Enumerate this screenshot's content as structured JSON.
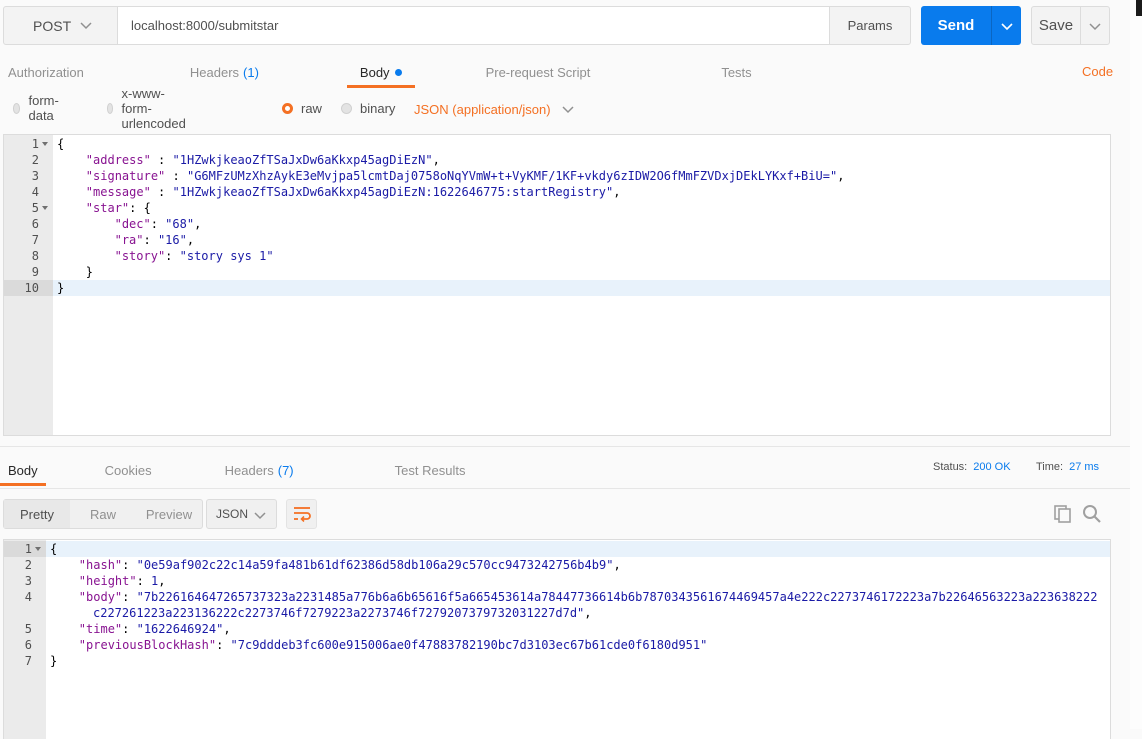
{
  "request": {
    "method": "POST",
    "url": "localhost:8000/submitstar",
    "params_label": "Params",
    "send_label": "Send",
    "save_label": "Save"
  },
  "request_tabs": [
    {
      "label": "Authorization",
      "count": null,
      "active": false,
      "dot": false
    },
    {
      "label": "Headers",
      "count": "(1)",
      "active": false,
      "dot": false
    },
    {
      "label": "Body",
      "count": null,
      "active": true,
      "dot": true
    },
    {
      "label": "Pre-request Script",
      "count": null,
      "active": false,
      "dot": false
    },
    {
      "label": "Tests",
      "count": null,
      "active": false,
      "dot": false
    }
  ],
  "code_link": "Code",
  "body_modes": [
    {
      "label": "form-data",
      "selected": false
    },
    {
      "label": "x-www-form-urlencoded",
      "selected": false
    },
    {
      "label": "raw",
      "selected": true
    },
    {
      "label": "binary",
      "selected": false
    }
  ],
  "content_type": "JSON (application/json)",
  "request_body": {
    "lines": [
      {
        "n": "1",
        "fold": true,
        "indent": 0,
        "parts": [
          [
            "p",
            "{"
          ]
        ]
      },
      {
        "n": "2",
        "fold": false,
        "indent": 1,
        "parts": [
          [
            "k",
            "\"address\""
          ],
          [
            "p",
            " : "
          ],
          [
            "s",
            "\"1HZwkjkeaoZfTSaJxDw6aKkxp45agDiEzN\""
          ],
          [
            "p",
            ","
          ]
        ]
      },
      {
        "n": "3",
        "fold": false,
        "indent": 1,
        "parts": [
          [
            "k",
            "\"signature\""
          ],
          [
            "p",
            " : "
          ],
          [
            "s",
            "\"G6MFzUMzXhzAykE3eMvjpa5lcmtDaj0758oNqYVmW+t+VyKMF/1KF+vkdy6zIDW2O6fMmFZVDxjDEkLYKxf+BiU=\""
          ],
          [
            "p",
            ","
          ]
        ]
      },
      {
        "n": "4",
        "fold": false,
        "indent": 1,
        "parts": [
          [
            "k",
            "\"message\""
          ],
          [
            "p",
            " : "
          ],
          [
            "s",
            "\"1HZwkjkeaoZfTSaJxDw6aKkxp45agDiEzN:1622646775:startRegistry\""
          ],
          [
            "p",
            ","
          ]
        ]
      },
      {
        "n": "5",
        "fold": true,
        "indent": 1,
        "parts": [
          [
            "k",
            "\"star\""
          ],
          [
            "p",
            ": {"
          ]
        ]
      },
      {
        "n": "6",
        "fold": false,
        "indent": 2,
        "parts": [
          [
            "k",
            "\"dec\""
          ],
          [
            "p",
            ": "
          ],
          [
            "s",
            "\"68\""
          ],
          [
            "p",
            ","
          ]
        ]
      },
      {
        "n": "7",
        "fold": false,
        "indent": 2,
        "parts": [
          [
            "k",
            "\"ra\""
          ],
          [
            "p",
            ": "
          ],
          [
            "s",
            "\"16\""
          ],
          [
            "p",
            ","
          ]
        ]
      },
      {
        "n": "8",
        "fold": false,
        "indent": 2,
        "parts": [
          [
            "k",
            "\"story\""
          ],
          [
            "p",
            ": "
          ],
          [
            "s",
            "\"story sys 1\""
          ]
        ]
      },
      {
        "n": "9",
        "fold": false,
        "indent": 1,
        "parts": [
          [
            "p",
            "}"
          ]
        ]
      },
      {
        "n": "10",
        "fold": false,
        "indent": 0,
        "parts": [
          [
            "p",
            "}"
          ]
        ],
        "highlight": true
      }
    ]
  },
  "response_tabs": [
    {
      "label": "Body",
      "count": null,
      "active": true
    },
    {
      "label": "Cookies",
      "count": null,
      "active": false
    },
    {
      "label": "Headers",
      "count": "(7)",
      "active": false
    },
    {
      "label": "Test Results",
      "count": null,
      "active": false
    }
  ],
  "status": {
    "label": "Status:",
    "value": "200 OK"
  },
  "time": {
    "label": "Time:",
    "value": "27 ms"
  },
  "view_modes": [
    {
      "label": "Pretty",
      "active": true
    },
    {
      "label": "Raw",
      "active": false
    },
    {
      "label": "Preview",
      "active": false
    }
  ],
  "format": "JSON",
  "response_body": {
    "lines": [
      {
        "n": "1",
        "fold": true,
        "indent": 0,
        "parts": [
          [
            "p",
            "{"
          ]
        ],
        "highlight": true
      },
      {
        "n": "2",
        "fold": false,
        "indent": 1,
        "parts": [
          [
            "k",
            "\"hash\""
          ],
          [
            "p",
            ": "
          ],
          [
            "s",
            "\"0e59af902c22c14a59fa481b61df62386d58db106a29c570cc9473242756b4b9\""
          ],
          [
            "p",
            ","
          ]
        ]
      },
      {
        "n": "3",
        "fold": false,
        "indent": 1,
        "parts": [
          [
            "k",
            "\"height\""
          ],
          [
            "p",
            ": "
          ],
          [
            "n",
            "1"
          ],
          [
            "p",
            ","
          ]
        ]
      },
      {
        "n": "4",
        "fold": false,
        "indent": 1,
        "parts": [
          [
            "k",
            "\"body\""
          ],
          [
            "p",
            ": "
          ],
          [
            "s",
            "\"7b226164647265737323a2231485a776b6a6b65616f5a665453614a78447736614b6b7870343561674469457a4e222c2273746172223a7b22646563223a223638222"
          ]
        ]
      },
      {
        "n": "",
        "fold": false,
        "indent": 1,
        "cont": true,
        "parts": [
          [
            "s",
            "c227261223a223136222c2273746f7279223a2273746f7279207379732031227d7d\""
          ],
          [
            "p",
            ","
          ]
        ]
      },
      {
        "n": "5",
        "fold": false,
        "indent": 1,
        "parts": [
          [
            "k",
            "\"time\""
          ],
          [
            "p",
            ": "
          ],
          [
            "s",
            "\"1622646924\""
          ],
          [
            "p",
            ","
          ]
        ]
      },
      {
        "n": "6",
        "fold": false,
        "indent": 1,
        "parts": [
          [
            "k",
            "\"previousBlockHash\""
          ],
          [
            "p",
            ": "
          ],
          [
            "s",
            "\"7c9dddeb3fc600e915006ae0f47883782190bc7d3103ec67b61cde0f6180d951\""
          ]
        ]
      },
      {
        "n": "7",
        "fold": false,
        "indent": 0,
        "parts": [
          [
            "p",
            "}"
          ]
        ]
      }
    ]
  },
  "icons": {
    "method_dropdown": "chevron-down-icon",
    "send_dropdown": "chevron-down-icon",
    "save_dropdown": "chevron-down-icon",
    "content_type_dropdown": "chevron-down-icon",
    "format_dropdown": "chevron-down-icon",
    "wrap": "wrap-lines-icon",
    "copy": "copy-icon",
    "search": "search-icon"
  },
  "colors": {
    "accent": "#f47023",
    "primary": "#097bed",
    "key": "#881391",
    "string": "#1a1aa6"
  }
}
